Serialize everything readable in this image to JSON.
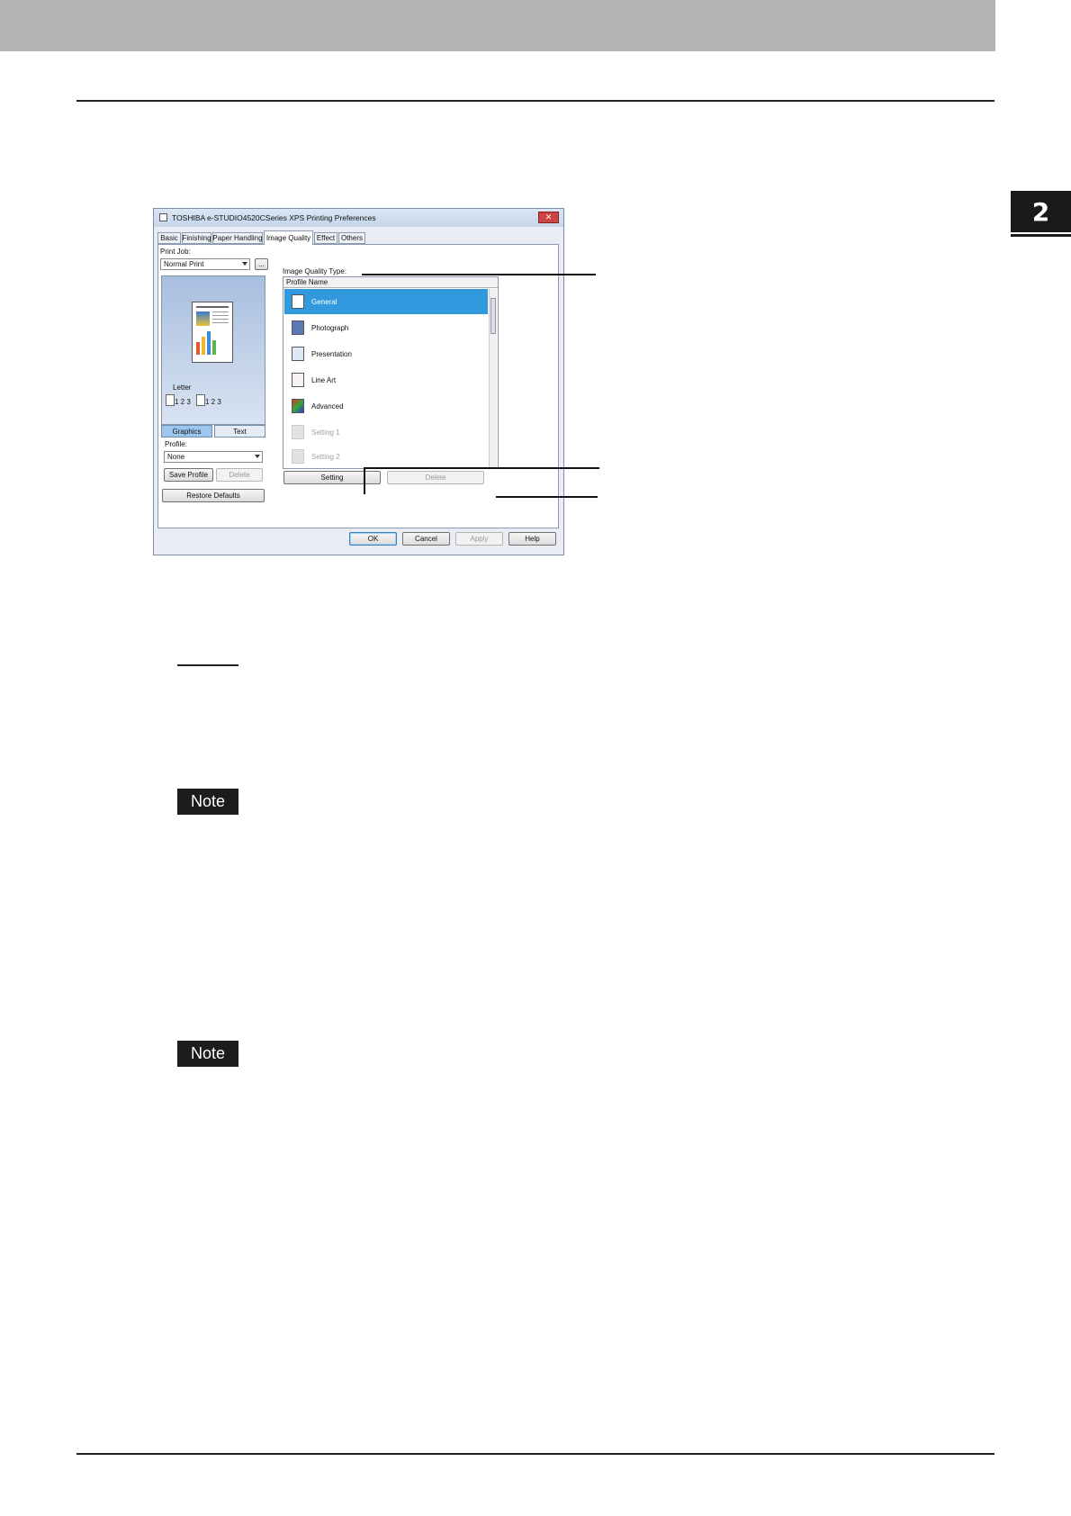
{
  "chapter_number": "2",
  "note_labels": [
    "Note",
    "Note"
  ],
  "dialog": {
    "title": "TOSHIBA e-STUDIO4520CSeries XPS Printing Preferences",
    "close_glyph": "✕",
    "tabs": [
      "Basic",
      "Finishing",
      "Paper Handling",
      "Image Quality",
      "Effect",
      "Others"
    ],
    "active_tab": "Image Quality",
    "print_job_label": "Print Job:",
    "print_job_value": "Normal Print",
    "ellipsis_label": "...",
    "paper_label": "Letter",
    "page_order_1": "1 2 3",
    "page_order_2": "1 2 3",
    "graphics_label": "Graphics",
    "text_label": "Text",
    "profile_label": "Profile:",
    "profile_value": "None",
    "save_profile_label": "Save Profile",
    "delete_profile_label": "Delete",
    "restore_defaults_label": "Restore Defaults",
    "image_quality_type_label": "Image Quality Type:",
    "list_header": "Profile Name",
    "profiles": [
      "General",
      "Photograph",
      "Presentation",
      "Line Art",
      "Advanced",
      "Setting 1",
      "Setting 2"
    ],
    "setting_label": "Setting",
    "delete_label": "Delete",
    "ok_label": "OK",
    "cancel_label": "Cancel",
    "apply_label": "Apply",
    "help_label": "Help"
  }
}
